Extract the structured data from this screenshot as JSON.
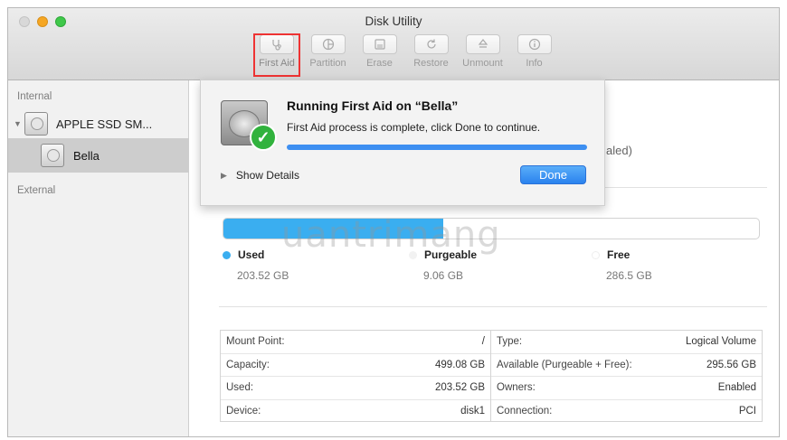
{
  "window": {
    "title": "Disk Utility"
  },
  "toolbar": {
    "items": [
      {
        "label": "First Aid",
        "icon": "stethoscope-icon",
        "highlighted": true
      },
      {
        "label": "Partition",
        "icon": "partition-icon"
      },
      {
        "label": "Erase",
        "icon": "erase-icon"
      },
      {
        "label": "Restore",
        "icon": "restore-icon"
      },
      {
        "label": "Unmount",
        "icon": "unmount-icon"
      },
      {
        "label": "Info",
        "icon": "info-icon"
      }
    ]
  },
  "sidebar": {
    "internal_header": "Internal",
    "disk_label": "APPLE SSD SM...",
    "volume_label": "Bella",
    "external_header": "External"
  },
  "main": {
    "partial_text": "aled)",
    "usage": {
      "used_fraction": 0.41,
      "used": {
        "label": "Used",
        "value": "203.52 GB",
        "color": "#3aaef0"
      },
      "purgeable": {
        "label": "Purgeable",
        "value": "9.06 GB",
        "color": "#f0f0f0"
      },
      "free": {
        "label": "Free",
        "value": "286.5 GB",
        "color": "#ffffff"
      }
    },
    "info_left": [
      {
        "key": "Mount Point:",
        "value": "/"
      },
      {
        "key": "Capacity:",
        "value": "499.08 GB"
      },
      {
        "key": "Used:",
        "value": "203.52 GB"
      },
      {
        "key": "Device:",
        "value": "disk1"
      }
    ],
    "info_right": [
      {
        "key": "Type:",
        "value": "Logical Volume"
      },
      {
        "key": "Available (Purgeable + Free):",
        "value": "295.56 GB"
      },
      {
        "key": "Owners:",
        "value": "Enabled"
      },
      {
        "key": "Connection:",
        "value": "PCI"
      }
    ]
  },
  "sheet": {
    "title": "Running First Aid on “Bella”",
    "message": "First Aid process is complete, click Done to continue.",
    "progress": 1.0,
    "show_details": "Show Details",
    "done": "Done"
  },
  "watermark": "uantrimang"
}
